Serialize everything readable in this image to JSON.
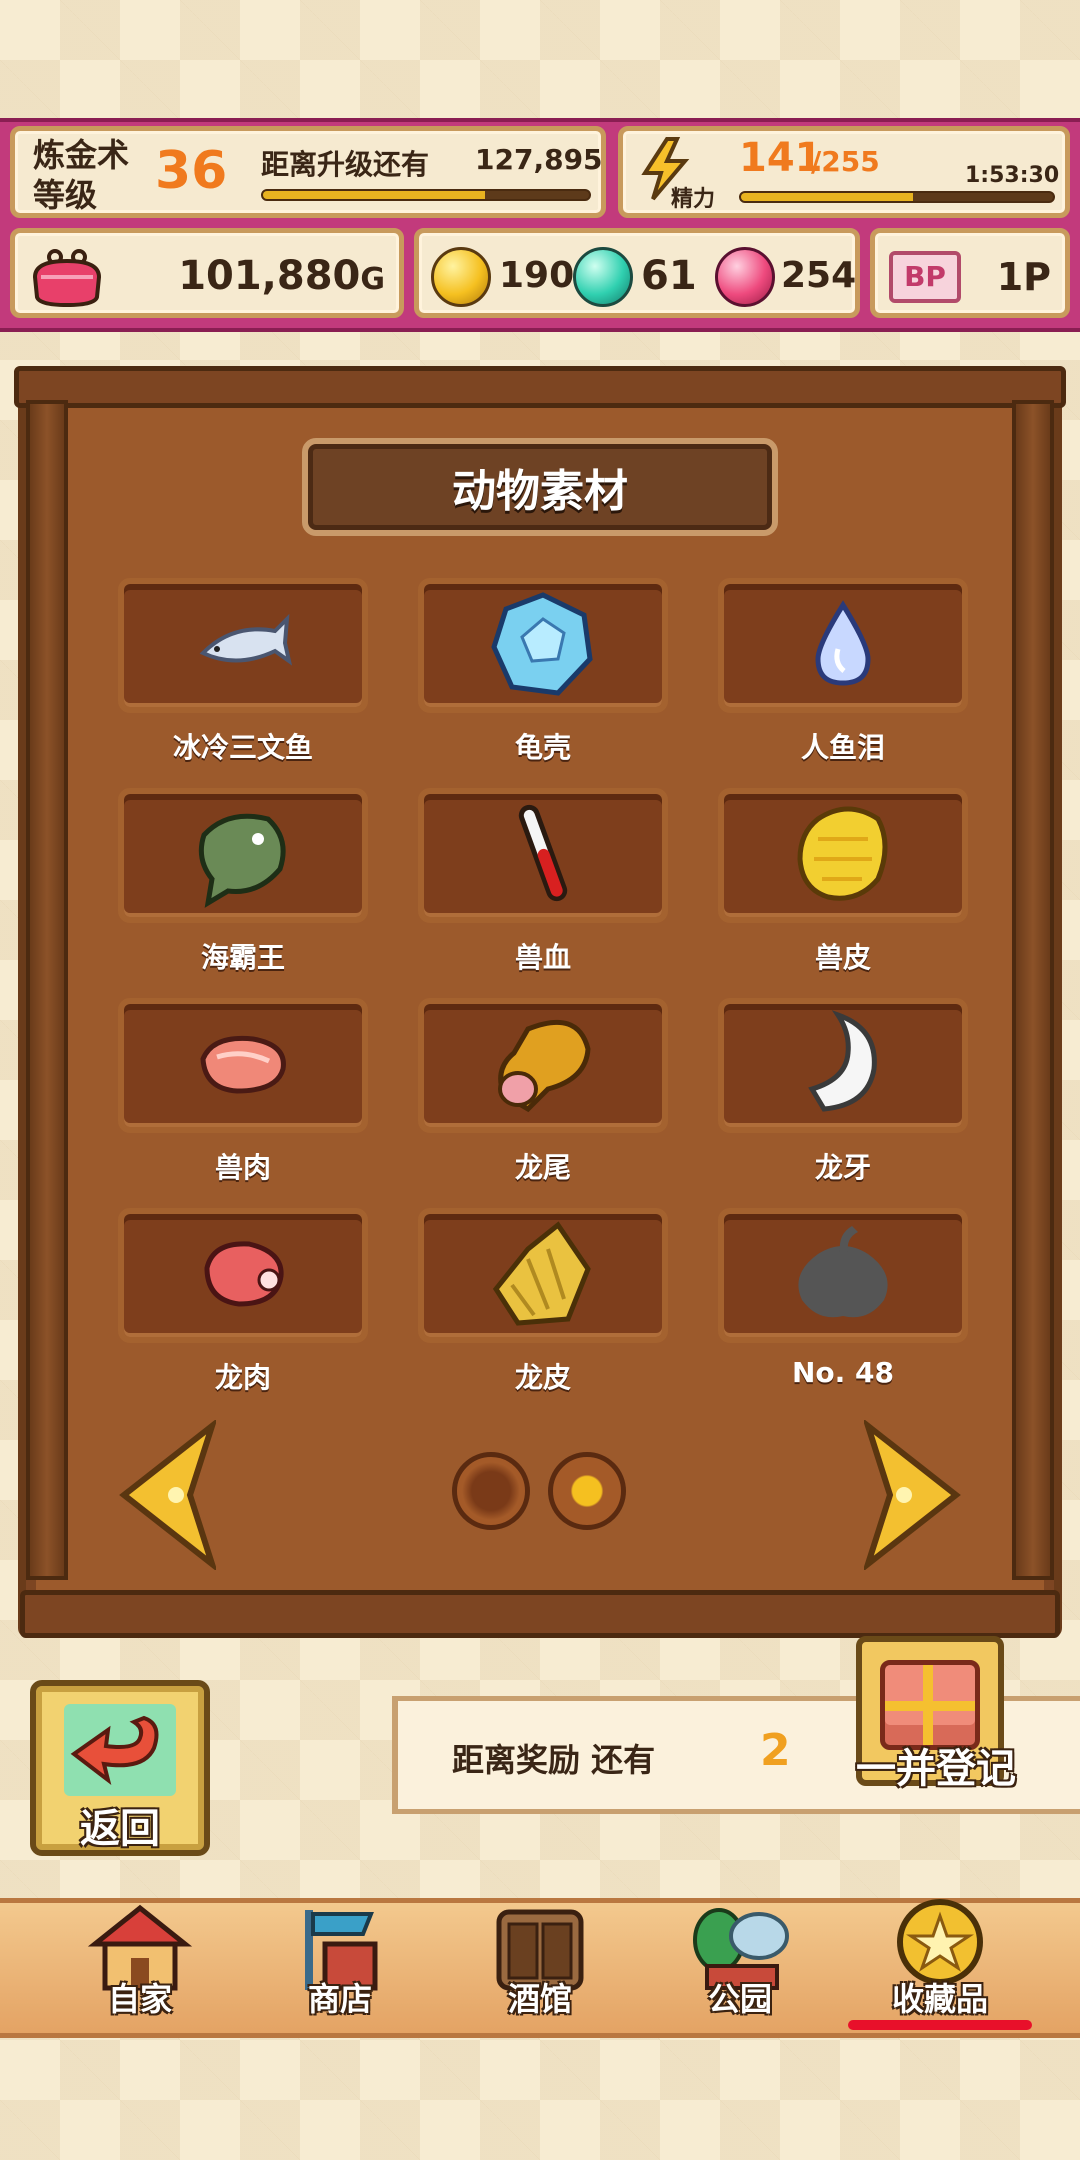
{
  "status": {
    "alchemy_label": "炼金术等级",
    "alchemy_level": "36",
    "next_level_label": "距离升级还有",
    "next_level_value": "127,895",
    "exp_progress": 0.68,
    "energy_label": "精力",
    "energy_current": "141",
    "energy_max": "/255",
    "energy_timer": "1:53:30",
    "energy_progress": 0.55,
    "gold": "101,880",
    "gold_unit": "G",
    "yellow_gems": "190",
    "teal_gems": "61",
    "pink_gems": "254",
    "bp_icon_text": "BP",
    "bp_value": "1P"
  },
  "collection": {
    "title": "动物素材",
    "items": [
      {
        "name": "冰冷三文鱼",
        "icon": "fish-icon"
      },
      {
        "name": "龟壳",
        "icon": "turtle-shell-icon"
      },
      {
        "name": "人鱼泪",
        "icon": "teardrop-icon"
      },
      {
        "name": "海霸王",
        "icon": "sea-king-icon"
      },
      {
        "name": "兽血",
        "icon": "blood-vial-icon"
      },
      {
        "name": "兽皮",
        "icon": "hide-icon"
      },
      {
        "name": "兽肉",
        "icon": "meat-icon"
      },
      {
        "name": "龙尾",
        "icon": "dragon-tail-icon"
      },
      {
        "name": "龙牙",
        "icon": "dragon-fang-icon"
      },
      {
        "name": "龙肉",
        "icon": "dragon-meat-icon"
      },
      {
        "name": "龙皮",
        "icon": "dragon-hide-icon"
      },
      {
        "name": "No. 48",
        "icon": "locked-silhouette-icon"
      }
    ],
    "page_current": 2,
    "page_total": 2
  },
  "back_label": "返回",
  "reward": {
    "label": "距离奖励 还有",
    "count": "2",
    "register_label": "一并登记"
  },
  "nav": [
    {
      "label": "自家",
      "icon": "house-icon"
    },
    {
      "label": "商店",
      "icon": "shop-icon"
    },
    {
      "label": "酒馆",
      "icon": "tavern-icon"
    },
    {
      "label": "公园",
      "icon": "park-icon"
    },
    {
      "label": "收藏品",
      "icon": "collection-medal-icon"
    }
  ],
  "colors": {
    "accent_orange": "#f07a1e",
    "header_border": "#b2306e",
    "board": "#9c5a2c"
  }
}
